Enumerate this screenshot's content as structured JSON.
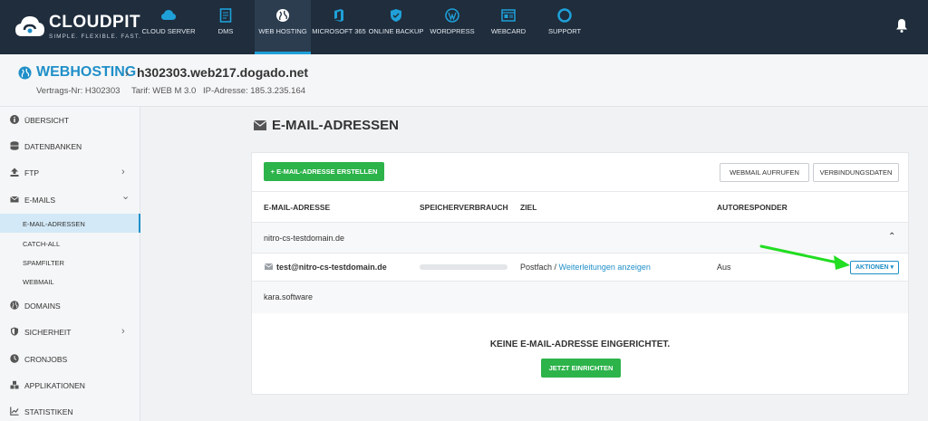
{
  "brand": {
    "name": "CLOUDPIT",
    "tagline": "SIMPLE. FLEXIBLE. FAST."
  },
  "nav": [
    {
      "label": "CLOUD SERVER",
      "icon": "cloud-icon"
    },
    {
      "label": "DMS",
      "icon": "document-icon"
    },
    {
      "label": "WEB HOSTING",
      "icon": "globe-icon",
      "active": true
    },
    {
      "label": "MICROSOFT 365",
      "icon": "office-icon"
    },
    {
      "label": "ONLINE BACKUP",
      "icon": "shield-icon"
    },
    {
      "label": "WORDPRESS",
      "icon": "wordpress-icon"
    },
    {
      "label": "WEBCARD",
      "icon": "webcard-icon"
    },
    {
      "label": "SUPPORT",
      "icon": "lifebuoy-icon"
    }
  ],
  "header": {
    "title": "WEBHOSTING",
    "host": "h302303.web217.dogado.net",
    "contract": "Vertrags-Nr: H302303",
    "tariff": "Tarif: WEB M 3.0",
    "ip": "IP-Adresse: 185.3.235.164"
  },
  "sidebar": {
    "items": [
      {
        "label": "ÜBERSICHT",
        "icon": "info-icon"
      },
      {
        "label": "DATENBANKEN",
        "icon": "database-icon"
      },
      {
        "label": "FTP",
        "icon": "upload-icon",
        "chevron": "›"
      },
      {
        "label": "E-MAILS",
        "icon": "envelope-icon",
        "chevron": "⌄"
      },
      {
        "label": "DOMAINS",
        "icon": "globe-icon"
      },
      {
        "label": "SICHERHEIT",
        "icon": "shield-icon",
        "chevron": "›"
      },
      {
        "label": "CRONJOBS",
        "icon": "clock-icon"
      },
      {
        "label": "APPLIKATIONEN",
        "icon": "cubes-icon"
      },
      {
        "label": "STATISTIKEN",
        "icon": "chart-icon"
      }
    ],
    "email_sub": [
      {
        "label": "E-MAIL-ADRESSEN",
        "active": true
      },
      {
        "label": "CATCH-ALL"
      },
      {
        "label": "SPAMFILTER"
      },
      {
        "label": "WEBMAIL"
      }
    ]
  },
  "main": {
    "title": "E-MAIL-ADRESSEN",
    "create_button": "+ E-MAIL-ADRESSE ERSTELLEN",
    "webmail_button": "WEBMAIL AUFRUFEN",
    "connection_button": "VERBINDUNGSDATEN",
    "columns": [
      "E-MAIL-ADRESSE",
      "SPEICHERVERBRAUCH",
      "ZIEL",
      "AUTORESPONDER"
    ],
    "domains": [
      {
        "name": "nitro-cs-testdomain.de",
        "collapse": "⌃",
        "entries": [
          {
            "address": "test@nitro-cs-testdomain.de",
            "target_prefix": "Postfach / ",
            "target_link": "Weiterleitungen anzeigen",
            "autoresponder": "Aus",
            "actions": "AKTIONEN ▾"
          }
        ]
      },
      {
        "name": "kara.software"
      }
    ],
    "empty_message": "KEINE E-MAIL-ADRESSE EINGERICHTET.",
    "setup_button": "JETZT EINRICHTEN"
  },
  "colors": {
    "accent": "#1f8fc8",
    "green": "#2cb34a",
    "topbar": "#1f2d3d",
    "arrow": "#22dd22"
  }
}
